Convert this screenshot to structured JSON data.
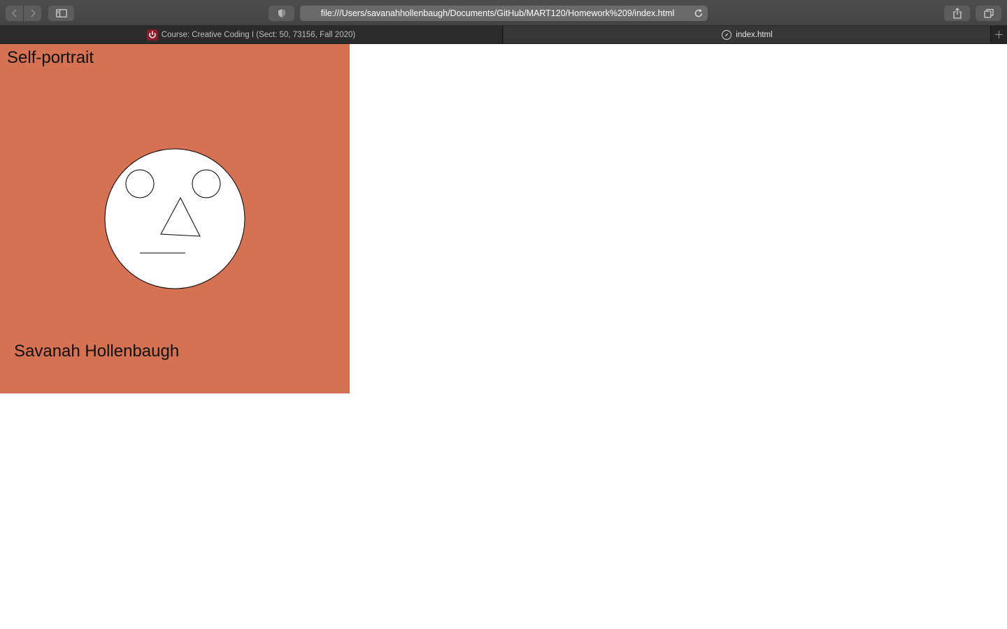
{
  "browser": {
    "url": "file:///Users/savanahhollenbaugh/Documents/GitHub/MART120/Homework%209/index.html",
    "tabs": [
      {
        "label": "Course: Creative Coding I (Sect: 50, 73156, Fall 2020)",
        "icon": "power-icon",
        "active": false
      },
      {
        "label": "index.html",
        "icon": "compass-icon",
        "active": true
      }
    ]
  },
  "page": {
    "title": "Self-portrait",
    "author": "Savanah Hollenbaugh",
    "background_color": "#d47253"
  }
}
